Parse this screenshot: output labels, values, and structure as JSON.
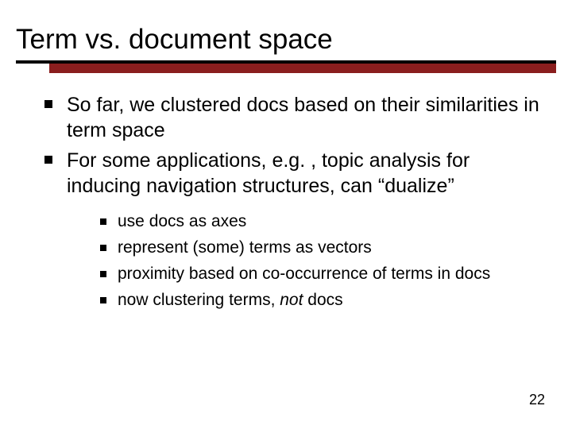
{
  "title": "Term vs. document space",
  "bullets": [
    {
      "text": "So far, we clustered docs based on their similarities in term space"
    },
    {
      "text": "For some applications, e.g. , topic analysis for inducing navigation structures, can “dualize”"
    }
  ],
  "subbullets": [
    {
      "text": "use docs as axes"
    },
    {
      "text": "represent (some) terms as vectors"
    },
    {
      "text": "proximity based on co-occurrence of terms in docs"
    },
    {
      "prefix": "now clustering terms, ",
      "italic": "not",
      "suffix": " docs"
    }
  ],
  "page_number": "22"
}
